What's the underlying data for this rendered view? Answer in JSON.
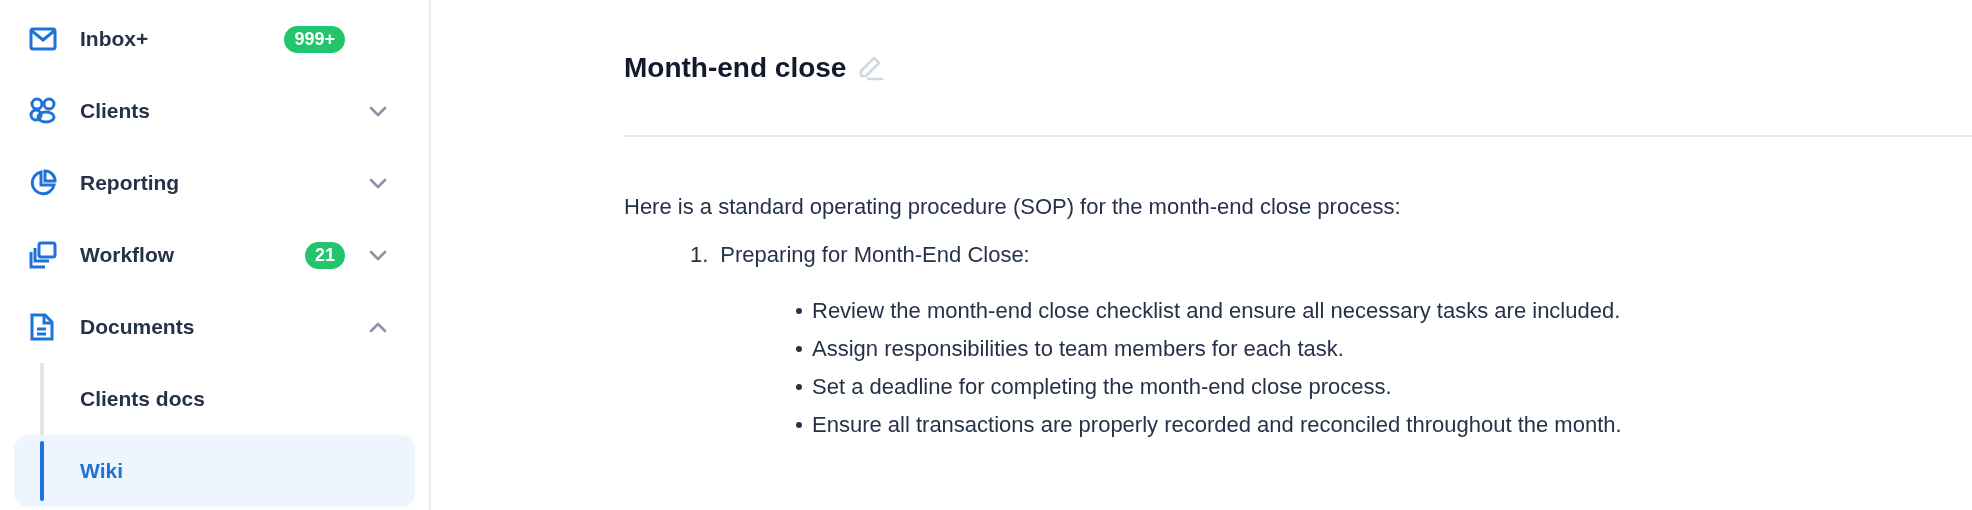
{
  "sidebar": {
    "items": [
      {
        "label": "Inbox+",
        "badge": "999+",
        "kind": "link"
      },
      {
        "label": "Clients",
        "kind": "group",
        "expanded": false
      },
      {
        "label": "Reporting",
        "kind": "group",
        "expanded": false
      },
      {
        "label": "Workflow",
        "badge": "21",
        "kind": "group",
        "expanded": false
      },
      {
        "label": "Documents",
        "kind": "group",
        "expanded": true,
        "children": [
          {
            "label": "Clients docs",
            "selected": false
          },
          {
            "label": "Wiki",
            "selected": true
          }
        ]
      }
    ]
  },
  "page": {
    "title": "Month-end close",
    "intro": "Here is a standard operating procedure (SOP) for the month-end close process:",
    "steps": [
      {
        "number": "1.",
        "title": "Preparing for Month-End Close:",
        "bullets": [
          "Review the month-end close checklist and ensure all necessary tasks are included.",
          "Assign responsibilities to team members for each task.",
          "Set a deadline for completing the month-end close process.",
          "Ensure all transactions are properly recorded and reconciled throughout the month."
        ]
      }
    ]
  }
}
